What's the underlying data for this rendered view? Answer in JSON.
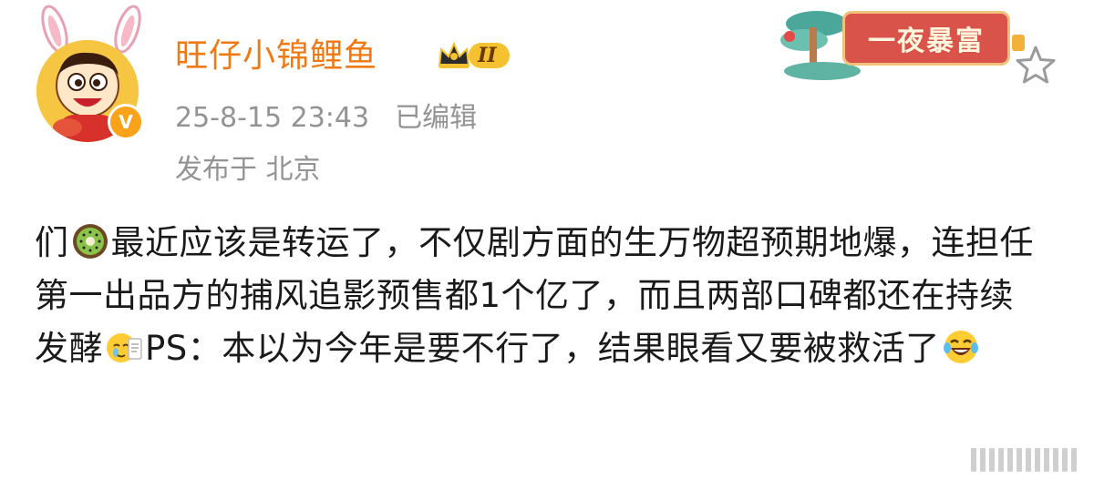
{
  "header": {
    "username": "旺仔小锦鲤鱼",
    "member_level": "II",
    "timestamp": "25-8-15 23:43",
    "edited_label": "已编辑",
    "location": "发布于 北京",
    "verified_mark": "V"
  },
  "decoration": {
    "banner_text": "一夜暴富"
  },
  "post": {
    "segments": [
      {
        "type": "text",
        "value": "们"
      },
      {
        "type": "emoji",
        "icon": "kiwi-emoji"
      },
      {
        "type": "text",
        "value": "最近应该是转运了，不仅剧方面的生万物超预期地爆，连担任第一出品方的捕风追影预售都1个亿了，而且两部口碑都还在持续发酵"
      },
      {
        "type": "emoji",
        "icon": "tearful-note-emoji"
      },
      {
        "type": "text",
        "value": "PS：本以为今年是要不行了，结果眼看又要被救活了"
      },
      {
        "type": "emoji",
        "icon": "laugh-cry-emoji"
      }
    ]
  },
  "colors": {
    "username": "#ef7a14",
    "meta_text": "#939393",
    "body_text": "#1a1a1a",
    "badge_gold": "#f4c230",
    "verified_orange": "#f9a21a",
    "banner_red": "#d9534a"
  }
}
